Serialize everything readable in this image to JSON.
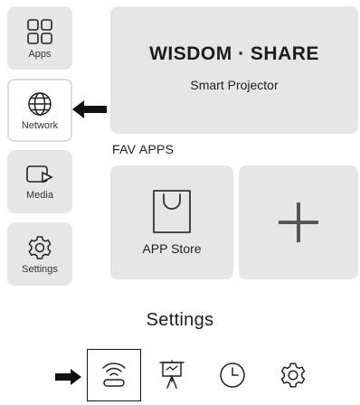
{
  "sidebar": {
    "items": [
      {
        "label": "Apps",
        "icon": "apps-grid-icon"
      },
      {
        "label": "Network",
        "icon": "globe-icon",
        "selected": true
      },
      {
        "label": "Media",
        "icon": "media-screen-icon"
      },
      {
        "label": "Settings",
        "icon": "gear-icon"
      }
    ]
  },
  "brand": {
    "title": "WISDOM · SHARE",
    "subtitle": "Smart Projector"
  },
  "fav_apps": {
    "label": "FAV APPS",
    "tiles": [
      {
        "label": "APP Store",
        "icon": "shopping-bag-icon"
      },
      {
        "label": "",
        "icon": "plus-icon"
      }
    ]
  },
  "settings_bar": {
    "title": "Settings",
    "items": [
      {
        "icon": "wifi-router-icon",
        "selected": true
      },
      {
        "icon": "projector-screen-icon"
      },
      {
        "icon": "clock-icon"
      },
      {
        "icon": "gear-icon"
      }
    ]
  },
  "colors": {
    "tile_bg": "#e6e6e6",
    "text": "#1b1b1b",
    "arrow": "#111111"
  }
}
